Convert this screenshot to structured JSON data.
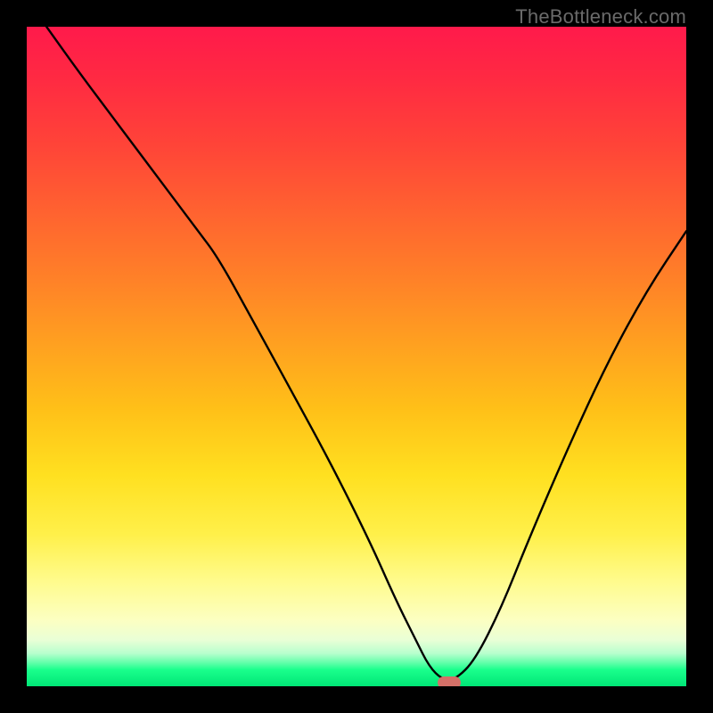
{
  "attribution": "TheBottleneck.com",
  "colors": {
    "frame": "#000000",
    "gradient_top": "#ff1a4b",
    "gradient_bottom": "#00e676",
    "curve": "#000000",
    "marker": "#d47068",
    "attribution_text": "#6a6a6a"
  },
  "chart_data": {
    "type": "line",
    "title": "",
    "xlabel": "",
    "ylabel": "",
    "xlim": [
      0,
      100
    ],
    "ylim": [
      0,
      100
    ],
    "series": [
      {
        "name": "bottleneck-curve",
        "x": [
          3,
          8,
          14,
          20,
          26,
          29,
          34,
          40,
          46,
          52,
          56,
          59,
          61,
          63,
          65,
          68,
          72,
          76,
          82,
          88,
          94,
          100
        ],
        "y": [
          100,
          93,
          85,
          77,
          69,
          65,
          56,
          45,
          34,
          22,
          13,
          7,
          3,
          1,
          1,
          4,
          12,
          22,
          36,
          49,
          60,
          69
        ]
      }
    ],
    "marker": {
      "x": 64,
      "y": 0.5
    }
  }
}
